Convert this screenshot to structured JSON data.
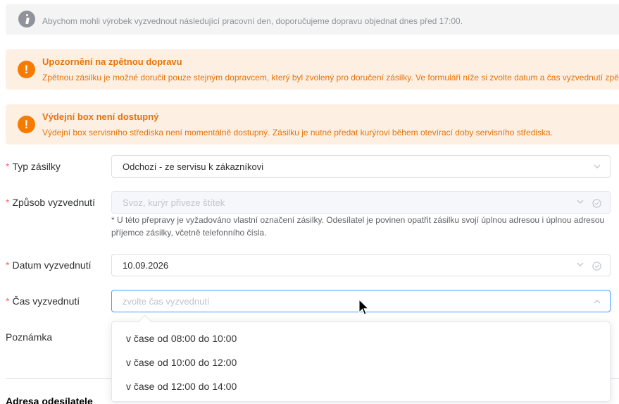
{
  "info_banner": {
    "text": "Abychom mohli výrobek vyzvednout následující pracovní den, doporučujeme dopravu objednat dnes před 17:00.",
    "icon": "info-icon"
  },
  "warning_return": {
    "title": "Upozornění na zpětnou dopravu",
    "text": "Zpětnou zásilku je možné doručit pouze stejným dopravcem, který byl zvolený pro doručení zásilky. Ve formuláři níže si zvolte datum a čas vyzvednutí zpě",
    "icon": "exclamation-icon"
  },
  "warning_box": {
    "title": "Výdejní box není dostupný",
    "text": "Výdejní box servisního střediska není momentálně dostupný. Zásilku je nutné předat kurýrovi během otevírací doby servisního střediska.",
    "icon": "exclamation-icon"
  },
  "form": {
    "required_mark": "*",
    "shipment_type": {
      "label": "Typ zásilky",
      "value": "Odchozí - ze servisu k zákazníkovi"
    },
    "pickup_method": {
      "label": "Způsob vyzvednutí",
      "value": "Svoz, kurýr přiveze štítek",
      "hint": "* U této přepravy je vyžadováno vlastní označení zásilky. Odesílatel je povinen opatřit zásilku svojí úplnou adresou i úplnou adresou příjemce zásilky, včetně telefonního čísla."
    },
    "pickup_date": {
      "label": "Datum vyzvednutí",
      "value": "10.09.2026"
    },
    "pickup_time": {
      "label": "Čas vyzvednutí",
      "placeholder": "zvolte čas vyzvednutí",
      "options": [
        "v čase od 08:00 do 10:00",
        "v čase od 10:00 do 12:00",
        "v čase od 12:00 do 14:00"
      ]
    },
    "note": {
      "label": "Poznámka"
    }
  },
  "sender_section": {
    "title": "Adresa odesílatele"
  },
  "colors": {
    "warning": "#e6730a",
    "warning_bg": "#fdf0e3",
    "info_bg": "#f4f4f5",
    "required": "#f56c6c",
    "focus": "#409eff"
  }
}
